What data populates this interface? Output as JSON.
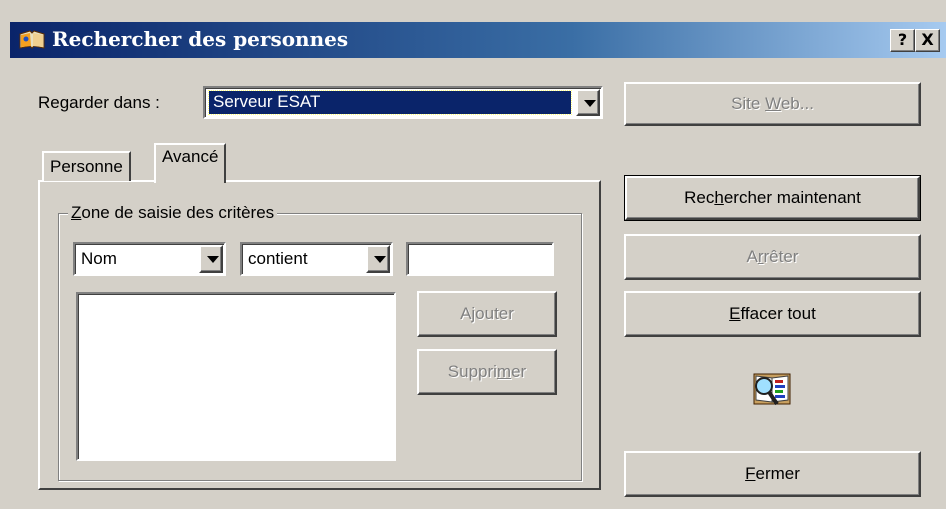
{
  "window": {
    "title": "Rechercher des personnes",
    "help_button": "?",
    "close_button": "X"
  },
  "look_in": {
    "label": "Regarder dans :",
    "value": "Serveur ESAT"
  },
  "buttons": {
    "website": {
      "before": "Site ",
      "mnemonic": "W",
      "after": "eb..."
    },
    "search_now": {
      "before": "Rec",
      "mnemonic": "h",
      "after": "ercher maintenant"
    },
    "stop": {
      "before": "A",
      "mnemonic": "r",
      "after": "rêter"
    },
    "clear_all": {
      "before": "",
      "mnemonic": "E",
      "after": "ffacer tout"
    },
    "close": {
      "before": "",
      "mnemonic": "F",
      "after": "ermer"
    },
    "add": "Ajouter",
    "remove": {
      "before": "Suppri",
      "mnemonic": "m",
      "after": "er"
    }
  },
  "tabs": [
    {
      "label": "Personne"
    },
    {
      "label": "Avancé",
      "selected": true
    }
  ],
  "criteria": {
    "group_title_mnemonic": "Z",
    "group_title_rest": "one de saisie des critères",
    "field_value": "Nom",
    "condition_value": "contient",
    "text_value": ""
  },
  "colors": {
    "title_gradient_start": "#0a246a",
    "title_gradient_end": "#a6caf0",
    "selection": "#0a246a",
    "face": "#d4d0c8"
  }
}
